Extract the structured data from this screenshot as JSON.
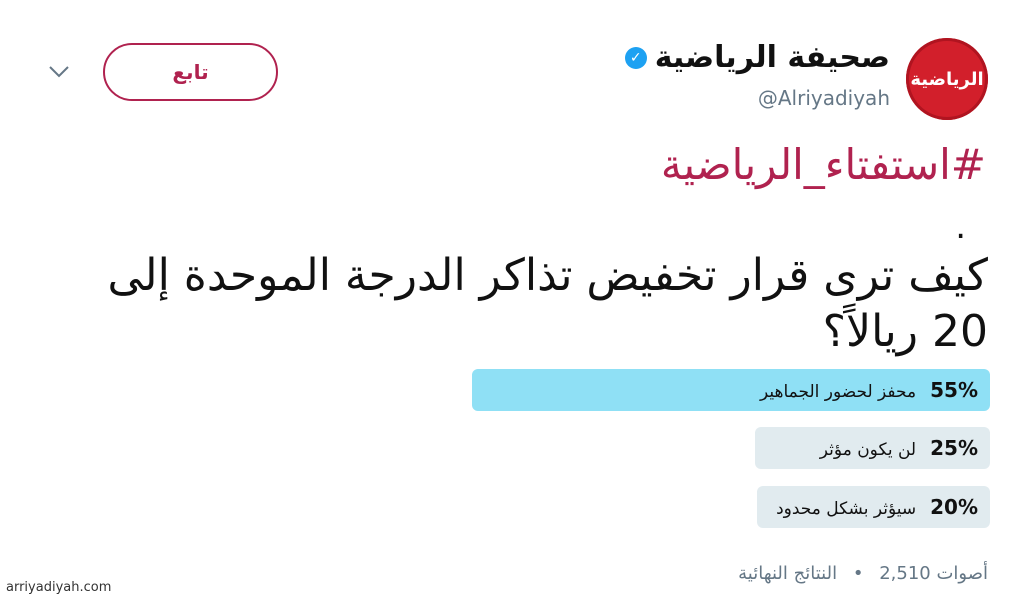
{
  "account": {
    "avatar_text": "الرياضية",
    "display_name": "صحيفة الرياضية",
    "handle": "@Alriyadiyah",
    "follow_label": "تابع"
  },
  "tweet": {
    "hashtag": "#استفتاء_الرياضية",
    "dot": ".",
    "question": "كيف ترى قرار تخفيض تذاكر الدرجة الموحدة إلى 20 ريالاً؟"
  },
  "poll": {
    "options": [
      {
        "percent": "55%",
        "value": 0.55,
        "label": "محفز لحضور الجماهير",
        "color": "#8fe0f5",
        "winner": true
      },
      {
        "percent": "25%",
        "value": 0.25,
        "label": "لن يكون مؤثر",
        "color": "#e1ebef",
        "winner": false
      },
      {
        "percent": "20%",
        "value": 0.2,
        "label": "سيؤثر بشكل محدود",
        "color": "#e1ebef",
        "winner": false
      }
    ],
    "votes": "أصوات 2,510",
    "separator": "•",
    "status": "النتائج النهائية"
  },
  "footer": {
    "site": "arriyadiyah.com"
  },
  "colors": {
    "brand": "#b0224f",
    "verified": "#1da1f2",
    "avatar": "#d21f2b"
  }
}
